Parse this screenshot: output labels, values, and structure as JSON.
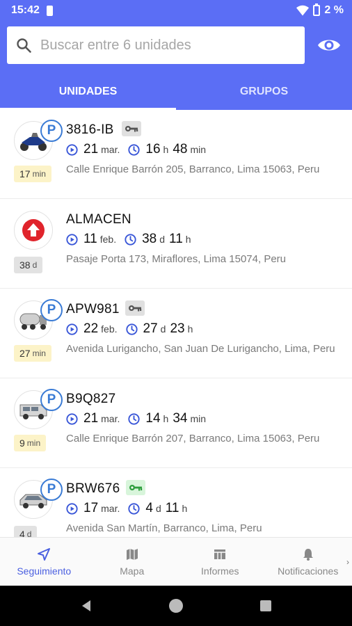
{
  "status_bar": {
    "time": "15:42",
    "battery": "2 %"
  },
  "search": {
    "placeholder": "Buscar entre 6 unidades"
  },
  "tabs": [
    {
      "label": "UNIDADES",
      "active": true
    },
    {
      "label": "GRUPOS",
      "active": false
    }
  ],
  "units": [
    {
      "name": "3816-IB",
      "icon": "motorcycle-icon",
      "parked": true,
      "ignition": "off",
      "date_day": "21",
      "date_month": "mar.",
      "duration_a": "16",
      "duration_a_unit": "h",
      "duration_b": "48",
      "duration_b_unit": "min",
      "address": "Calle Enrique Barrón 205, Barranco, Lima 15063, Peru",
      "age_value": "17",
      "age_unit": "min",
      "age_style": "yellow"
    },
    {
      "name": "ALMACEN",
      "icon": "red-arrow-up-icon",
      "parked": false,
      "ignition": "none",
      "date_day": "11",
      "date_month": "feb.",
      "duration_a": "38",
      "duration_a_unit": "d",
      "duration_b": "11",
      "duration_b_unit": "h",
      "address": "Pasaje Porta 173, Miraflores, Lima 15074, Peru",
      "age_value": "38",
      "age_unit": "d",
      "age_style": "gray"
    },
    {
      "name": "APW981",
      "icon": "tanker-truck-icon",
      "parked": true,
      "ignition": "off",
      "date_day": "22",
      "date_month": "feb.",
      "duration_a": "27",
      "duration_a_unit": "d",
      "duration_b": "23",
      "duration_b_unit": "h",
      "address": "Avenida Lurigancho, San Juan De Lurigancho, Lima, Peru",
      "age_value": "27",
      "age_unit": "min",
      "age_style": "yellow"
    },
    {
      "name": "B9Q827",
      "icon": "van-icon",
      "parked": true,
      "ignition": "none",
      "date_day": "21",
      "date_month": "mar.",
      "duration_a": "14",
      "duration_a_unit": "h",
      "duration_b": "34",
      "duration_b_unit": "min",
      "address": "Calle Enrique Barrón 207, Barranco, Lima 15063, Peru",
      "age_value": "9",
      "age_unit": "min",
      "age_style": "yellow"
    },
    {
      "name": "BRW676",
      "icon": "car-icon",
      "parked": true,
      "ignition": "on",
      "date_day": "17",
      "date_month": "mar.",
      "duration_a": "4",
      "duration_a_unit": "d",
      "duration_b": "11",
      "duration_b_unit": "h",
      "address": "Avenida San Martín, Barranco, Lima, Peru",
      "age_value": "4",
      "age_unit": "d",
      "age_style": "gray"
    }
  ],
  "parked_letter": "P",
  "bottom_nav": [
    {
      "label": "Seguimiento",
      "icon": "navigation-arrow-icon",
      "active": true
    },
    {
      "label": "Mapa",
      "icon": "map-icon",
      "active": false
    },
    {
      "label": "Informes",
      "icon": "table-icon",
      "active": false
    },
    {
      "label": "Notificaciones",
      "icon": "bell-icon",
      "active": false
    }
  ],
  "colors": {
    "primary": "#5b6ef5",
    "accent": "#3a7bd5",
    "key_on": "#2e9e3e",
    "key_off": "#555555"
  }
}
